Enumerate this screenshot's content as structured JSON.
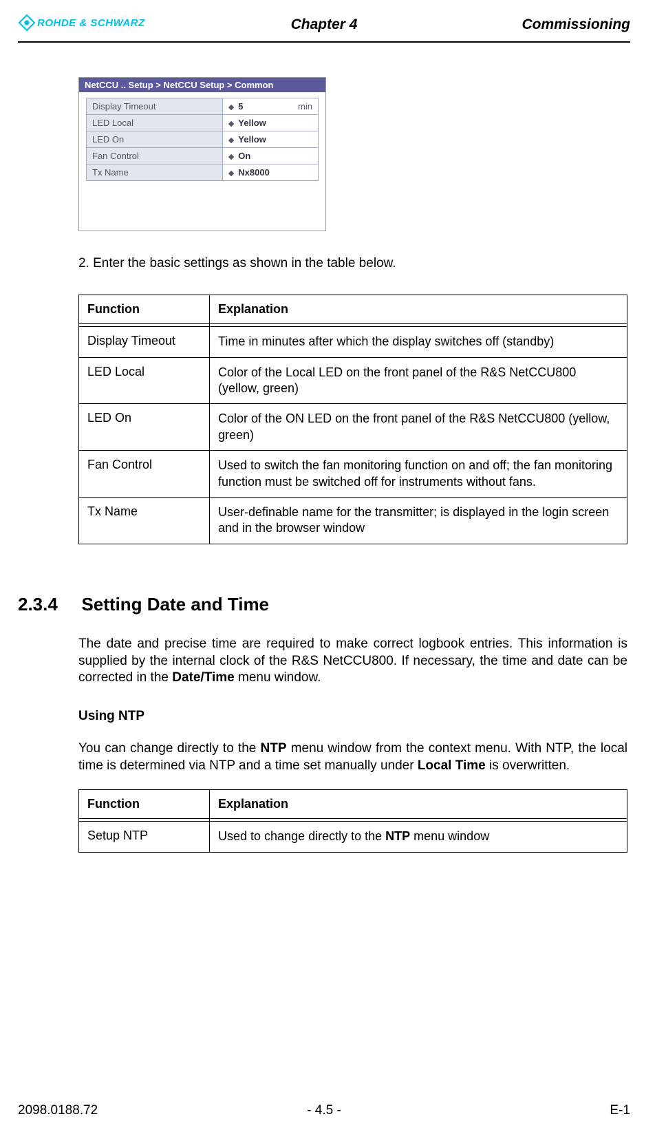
{
  "header": {
    "logo_text": "ROHDE & SCHWARZ",
    "chapter": "Chapter 4",
    "title": "Commissioning"
  },
  "screenshot": {
    "breadcrumb": "NetCCU .. Setup > NetCCU Setup > Common",
    "rows": [
      {
        "label": "Display Timeout",
        "value": "5",
        "unit": "min"
      },
      {
        "label": "LED Local",
        "value": "Yellow",
        "unit": ""
      },
      {
        "label": "LED On",
        "value": "Yellow",
        "unit": ""
      },
      {
        "label": "Fan Control",
        "value": "On",
        "unit": ""
      },
      {
        "label": "Tx Name",
        "value": "Nx8000",
        "unit": ""
      }
    ]
  },
  "step_text": "2.  Enter the basic settings as shown in the table below.",
  "table1": {
    "head_fn": "Function",
    "head_ex": "Explanation",
    "rows": [
      {
        "fn": "Display Timeout",
        "ex": "Time in minutes after which the display switches off (standby)"
      },
      {
        "fn": "LED Local",
        "ex": "Color of the Local LED on the front panel of the R&S NetCCU800 (yellow, green)"
      },
      {
        "fn": "LED On",
        "ex": "Color of the ON LED on the front panel of the R&S NetCCU800 (yellow, green)"
      },
      {
        "fn": "Fan Control",
        "ex": "Used to switch the fan monitoring function on and off; the fan monitoring function must be switched off for instruments without fans."
      },
      {
        "fn": "Tx Name",
        "ex": "User-definable name for the transmitter; is displayed in the login screen and in the browser window"
      }
    ]
  },
  "section": {
    "num": "2.3.4",
    "title": "Setting Date and Time",
    "para1_a": "The date and precise time are required to make correct logbook entries. This information is supplied by the internal clock of the R&S NetCCU800. If necessary, the time and date can be corrected in the ",
    "para1_b": "Date/Time",
    "para1_c": " menu window.",
    "sub": "Using NTP",
    "para2_a": "You can change directly to the ",
    "para2_b": "NTP",
    "para2_c": " menu window from the context menu. With NTP, the local time is determined via NTP and a time set manually under ",
    "para2_d": "Local Time",
    "para2_e": " is overwritten."
  },
  "table2": {
    "head_fn": "Function",
    "head_ex": "Explanation",
    "rows": [
      {
        "fn": "Setup NTP",
        "ex_a": "Used to change directly to the ",
        "ex_b": "NTP",
        "ex_c": " menu window"
      }
    ]
  },
  "footer": {
    "left": "2098.0188.72",
    "center": "- 4.5 -",
    "right": "E-1"
  }
}
